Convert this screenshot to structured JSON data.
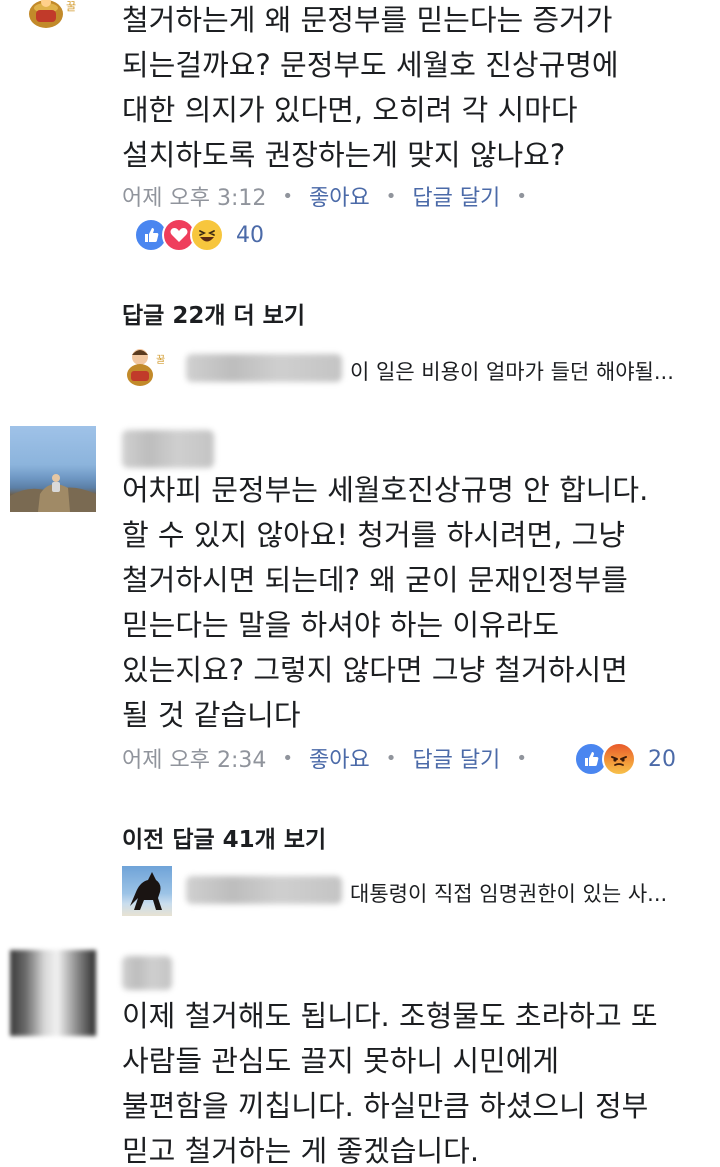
{
  "comments": [
    {
      "lines": [
        "철거하는게 왜 문정부를 믿는다는 증거가",
        "되는걸까요? 문정부도 세월호 진상규명에",
        "대한 의지가 있다면, 오히려 각 시마다",
        "설치하도록 권장하는게 맞지 않나요?"
      ],
      "time": "어제 오후 3:12",
      "like_label": "좋아요",
      "reply_label": "답글 달기",
      "reaction_count": "40",
      "more_replies": "답글 22개 더 보기",
      "reply_preview": "이 일은 비용이 얼마가 들던 해야될..."
    },
    {
      "lines": [
        "어차피 문정부는 세월호진상규명 안 합니다.",
        "할 수 있지 않아요! 청거를 하시려면, 그냥",
        "철거하시면 되는데? 왜 굳이 문재인정부를",
        "믿는다는 말을 하셔야 하는 이유라도",
        "있는지요? 그렇지 않다면 그냥 철거하시면",
        "될 것 같습니다"
      ],
      "time": "어제 오후 2:34",
      "like_label": "좋아요",
      "reply_label": "답글 달기",
      "reaction_count": "20",
      "more_replies": "이전 답글 41개 보기",
      "reply_preview": "대통령이 직접 임명권한이 있는 사..."
    },
    {
      "lines": [
        "이제 철거해도 됩니다. 조형물도 초라하고 또",
        "사람들 관심도 끌지 못하니 시민에게",
        "불편함을 끼칩니다. 하실만큼 하셨으니 정부",
        "믿고 철거하는 게 좋겠습니다."
      ]
    }
  ],
  "colors": {
    "text": "#1c1e21",
    "meta": "#90949c",
    "link": "#4b6aa8",
    "like": "#4a86f0",
    "love": "#ef3e5c",
    "haha": "#f7c63d"
  },
  "icons": {
    "reactions_1": [
      "like-icon",
      "love-icon",
      "haha-icon"
    ],
    "reactions_2": [
      "like-icon",
      "angry-icon"
    ]
  }
}
